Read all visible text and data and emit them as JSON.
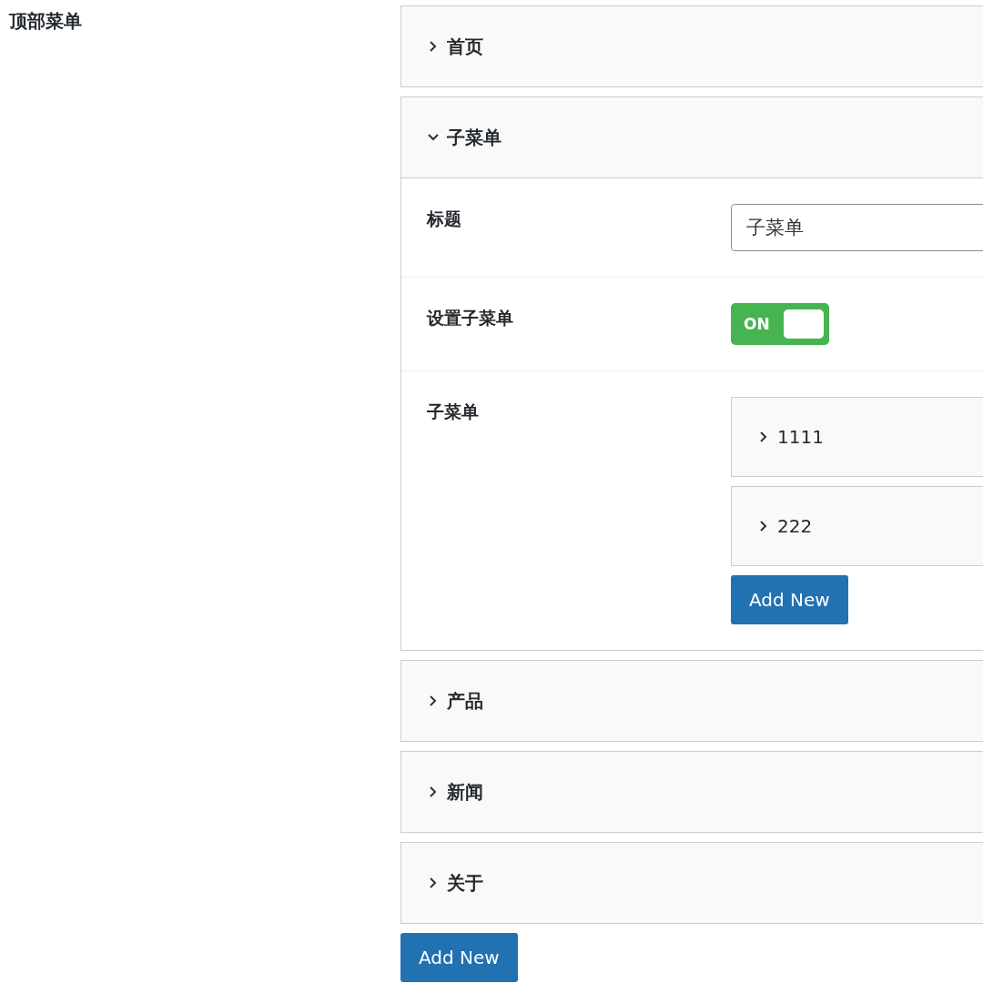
{
  "section_label": "顶部菜单",
  "menu_items": [
    {
      "title": "首页",
      "expanded": false
    },
    {
      "title": "子菜单",
      "expanded": true,
      "fields": [
        {
          "kind": "text",
          "label": "标题",
          "value": "子菜单"
        },
        {
          "kind": "toggle",
          "label": "设置子菜单",
          "on": true,
          "on_label": "ON"
        },
        {
          "kind": "repeater",
          "label": "子菜单",
          "items": [
            {
              "title": "1111",
              "expanded": false
            },
            {
              "title": "222",
              "expanded": false
            }
          ],
          "add_button": "Add New"
        }
      ]
    },
    {
      "title": "产品",
      "expanded": false
    },
    {
      "title": "新闻",
      "expanded": false
    },
    {
      "title": "关于",
      "expanded": false
    }
  ],
  "add_button": "Add New"
}
